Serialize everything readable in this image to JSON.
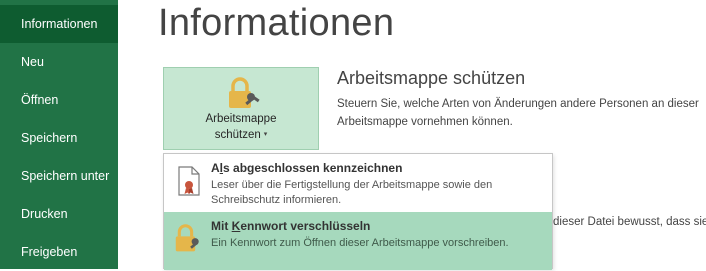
{
  "sidebar": {
    "items": [
      {
        "label": "Informationen",
        "active": true
      },
      {
        "label": "Neu"
      },
      {
        "label": "Öffnen"
      },
      {
        "label": "Speichern"
      },
      {
        "label": "Speichern unter"
      },
      {
        "label": "Drucken"
      },
      {
        "label": "Freigeben"
      }
    ]
  },
  "main": {
    "title": "Informationen",
    "protect_button": {
      "line1": "Arbeitsmappe",
      "line2": "schützen",
      "caret": "▾",
      "icon": "lock-key-icon"
    },
    "protect_section": {
      "heading": "Arbeitsmappe schützen",
      "desc_line1": "Steuern Sie, welche Arten von Änderungen andere Personen an dieser",
      "desc_line2": "Arbeitsmappe vornehmen können."
    },
    "background_text": "dieser Datei bewusst, dass sie"
  },
  "dropdown": {
    "items": [
      {
        "title_pre": "A",
        "title_accel": "l",
        "title_post": "s abgeschlossen kennzeichnen",
        "desc": "Leser über die Fertigstellung der Arbeitsmappe sowie den Schreibschutz informieren.",
        "icon": "document-final-icon"
      },
      {
        "title_pre": "Mit ",
        "title_accel": "K",
        "title_post": "ennwort verschlüsseln",
        "desc": "Ein Kennwort zum Öffnen dieser Arbeitsmappe vorschreiben.",
        "icon": "lock-key-icon",
        "highlighted": true
      }
    ]
  },
  "colors": {
    "sidebar": "#217346",
    "sidebar_active": "#0e5c30",
    "button_bg": "#c6e7d2",
    "menu_hover": "#a6d9bd",
    "lock_gold": "#e5b64a"
  }
}
